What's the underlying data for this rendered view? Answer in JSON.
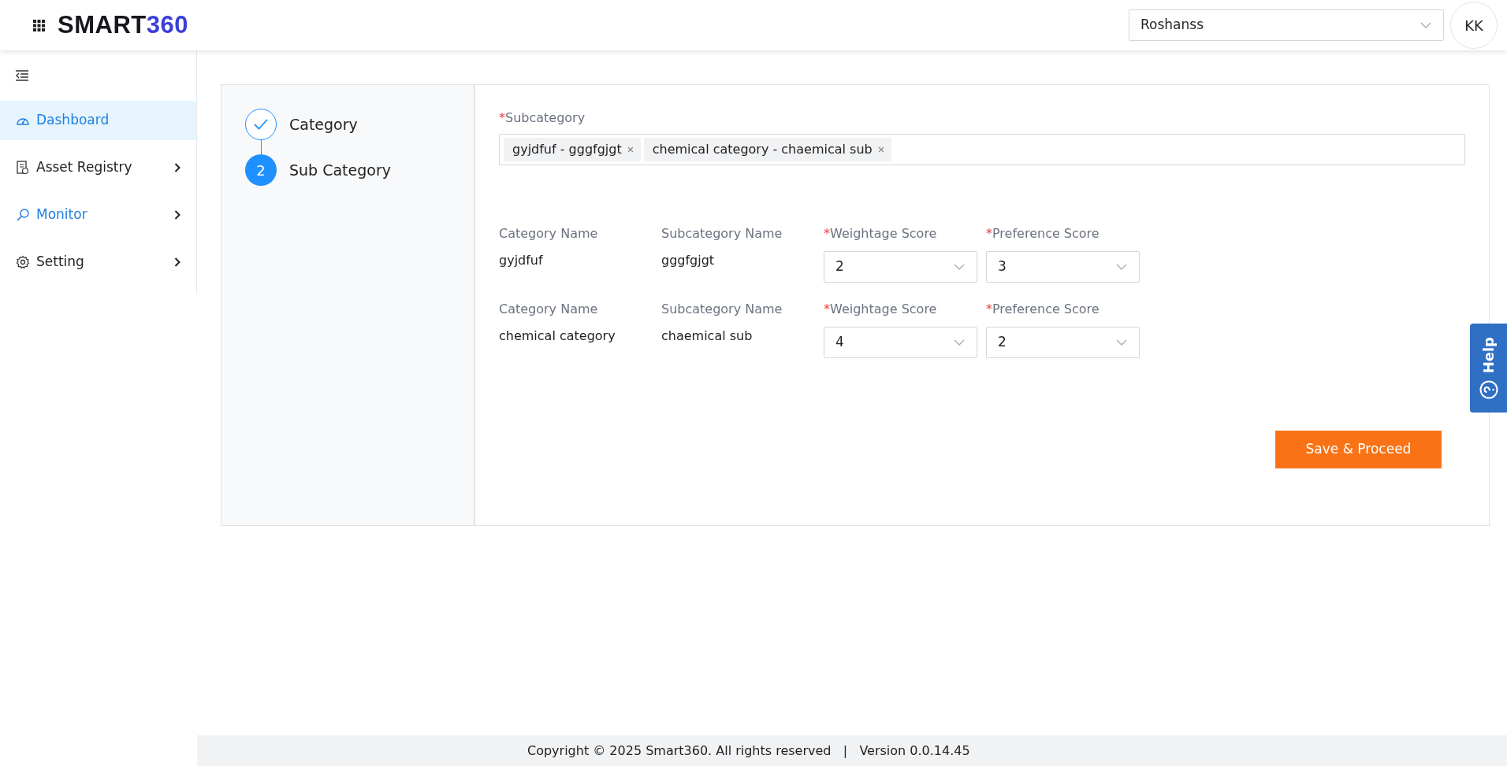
{
  "header": {
    "logo": {
      "text": "SMART",
      "accent": "360"
    },
    "org_select": {
      "value": "Roshanss"
    },
    "avatar": {
      "initials": "KK"
    }
  },
  "sidebar": {
    "items": [
      {
        "label": "Dashboard",
        "kind": "gauge",
        "selected": true,
        "highlighted": true,
        "has_children": false
      },
      {
        "label": "Asset Registry",
        "kind": "document",
        "selected": false,
        "highlighted": false,
        "has_children": true
      },
      {
        "label": "Monitor",
        "kind": "magnifier",
        "selected": false,
        "highlighted": true,
        "has_children": true
      },
      {
        "label": "Setting",
        "kind": "gear",
        "selected": false,
        "highlighted": false,
        "has_children": true
      }
    ]
  },
  "stepper": {
    "steps": [
      {
        "label": "Category",
        "kind": "done"
      },
      {
        "label": "Sub Category",
        "kind": "current",
        "number": "2"
      }
    ]
  },
  "form": {
    "subcategory": {
      "label": "Subcategory",
      "required_mark": "*",
      "tags": [
        "gyjdfuf - gggfgjgt",
        "chemical category - chaemical sub"
      ]
    },
    "rows": [
      {
        "category_label": "Category Name",
        "category": "gyjdfuf",
        "subcategory_label": "Subcategory Name",
        "subcategory": "gggfgjgt",
        "weightage_label": "Weightage Score",
        "weightage": "2",
        "preference_label": "Preference Score",
        "preference": "3"
      },
      {
        "category_label": "Category Name",
        "category": "chemical category",
        "subcategory_label": "Subcategory Name",
        "subcategory": "chaemical sub",
        "weightage_label": "Weightage Score",
        "weightage": "4",
        "preference_label": "Preference Score",
        "preference": "2"
      }
    ],
    "required_mark": "*",
    "submit": "Save & Proceed"
  },
  "help_tab": {
    "label": "Help"
  },
  "footer": {
    "text": "Copyright © 2025 Smart360. All rights reserved   |   Version 0.0.14.45"
  }
}
